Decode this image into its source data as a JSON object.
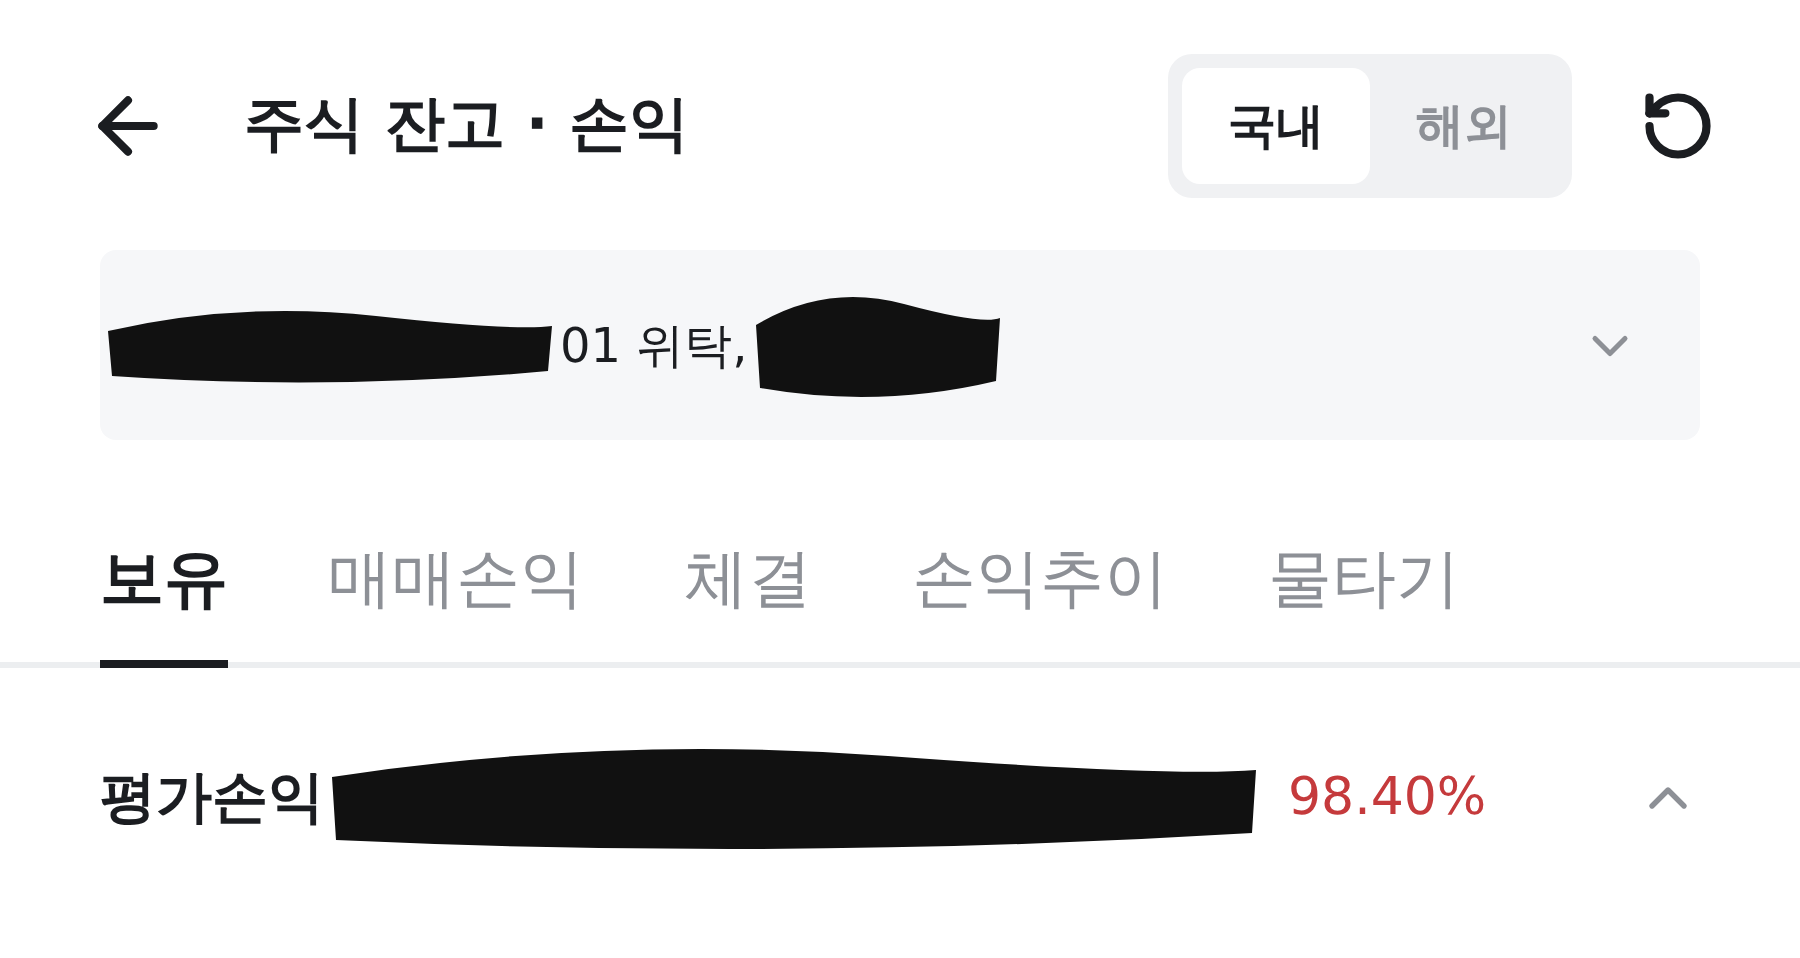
{
  "header": {
    "title": "주식 잔고 · 손익",
    "market_toggle": [
      {
        "label": "국내",
        "selected": true
      },
      {
        "label": "해외",
        "selected": false
      }
    ]
  },
  "account": {
    "visible_text": "01 위탁,"
  },
  "tabs": [
    {
      "label": "보유",
      "selected": true
    },
    {
      "label": "매매손익",
      "selected": false
    },
    {
      "label": "체결",
      "selected": false
    },
    {
      "label": "손익추이",
      "selected": false
    },
    {
      "label": "물타기",
      "selected": false
    }
  ],
  "summary": {
    "label": "평가손익",
    "rate": "98.40%",
    "expanded": true
  }
}
